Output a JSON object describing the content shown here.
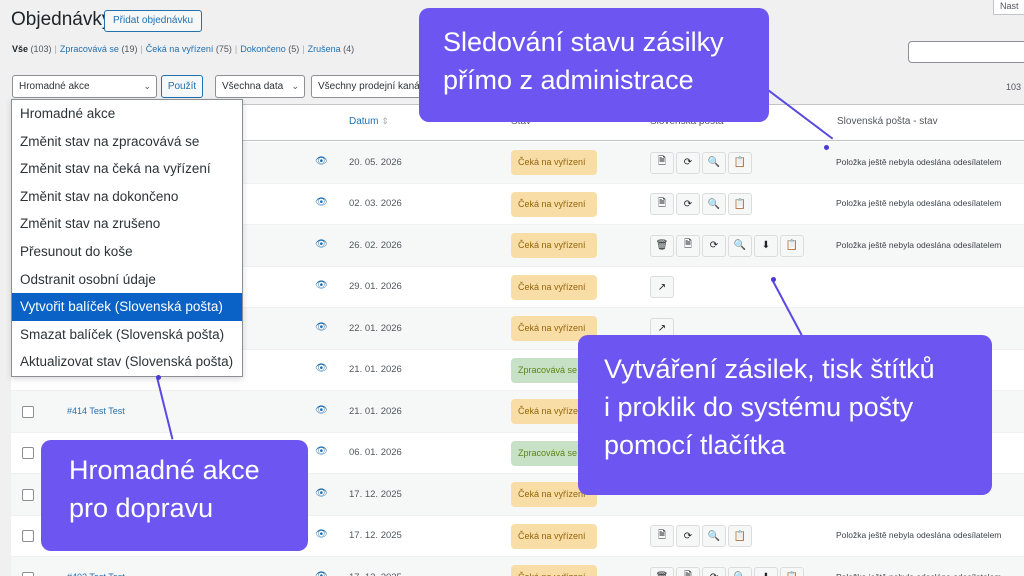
{
  "header": {
    "title": "Objednávky",
    "add_button": "Přidat objednávku",
    "screen_options": "Nast"
  },
  "views": [
    {
      "label": "Vše",
      "count": "(103)"
    },
    {
      "label": "Zpracovává se",
      "count": "(19)"
    },
    {
      "label": "Čeká na vyřízení",
      "count": "(75)"
    },
    {
      "label": "Dokončeno",
      "count": "(5)"
    },
    {
      "label": "Zrušena",
      "count": "(4)"
    }
  ],
  "filters": {
    "bulk_select": "Hromadné akce",
    "apply": "Použít",
    "date_select": "Všechna data",
    "channel_select": "Všechny prodejní kaná",
    "item_count": "103"
  },
  "table": {
    "headers": {
      "date": "Datum",
      "status": "Stav",
      "post": "Slovenská pošta",
      "post_status": "Slovenská pošta - stav"
    },
    "rows": [
      {
        "order": "",
        "date": "20. 05. 2026",
        "status": "Čeká na vyřízení",
        "status_type": "hold",
        "icons": [
          "doc",
          "refresh",
          "search",
          "sheet"
        ],
        "post_status": "Položka ještě nebyla odeslána odesílatelem"
      },
      {
        "order": "",
        "date": "02. 03. 2026",
        "status": "Čeká na vyřízení",
        "status_type": "hold",
        "icons": [
          "doc",
          "refresh",
          "search",
          "sheet"
        ],
        "post_status": "Položka ještě nebyla odeslána odesílatelem"
      },
      {
        "order": "",
        "date": "26. 02. 2026",
        "status": "Čeká na vyřízení",
        "status_type": "hold",
        "icons": [
          "trash",
          "doc",
          "refresh",
          "search",
          "download",
          "sheet"
        ],
        "post_status": "Položka ještě nebyla odeslána odesílatelem"
      },
      {
        "order": "",
        "date": "29. 01. 2026",
        "status": "Čeká na vyřízení",
        "status_type": "hold",
        "icons": [
          "external"
        ],
        "post_status": ""
      },
      {
        "order": "",
        "date": "22. 01. 2026",
        "status": "Čeká na vyřízení",
        "status_type": "hold",
        "icons": [
          "external"
        ],
        "post_status": ""
      },
      {
        "order": "",
        "date": "21. 01. 2026",
        "status": "Zpracovává se",
        "status_type": "proc",
        "icons": [],
        "post_status": "telem"
      },
      {
        "order": "#414 Test Test",
        "date": "21. 01. 2026",
        "status": "Čeká na vyřízení",
        "status_type": "hold",
        "icons": [],
        "post_status": "telem"
      },
      {
        "order": "",
        "date": "06. 01. 2026",
        "status": "Zpracovává se",
        "status_type": "proc",
        "icons": [],
        "post_status": ""
      },
      {
        "order": "",
        "date": "17. 12. 2025",
        "status": "Čeká na vyřízení",
        "status_type": "hold",
        "icons": [],
        "post_status": ""
      },
      {
        "order": "",
        "date": "17. 12. 2025",
        "status": "Čeká na vyřízení",
        "status_type": "hold",
        "icons": [
          "doc",
          "refresh",
          "search",
          "sheet"
        ],
        "post_status": "Položka ještě nebyla odeslána odesílatelem"
      },
      {
        "order": "#402 Test Test",
        "date": "17. 12. 2025",
        "status": "Čeká na vyřízení",
        "status_type": "hold",
        "icons": [
          "trash",
          "doc",
          "refresh",
          "search",
          "download",
          "sheet"
        ],
        "post_status": "Položka ještě nebyla odeslána odesílatelem"
      }
    ]
  },
  "bulk_menu": {
    "items": [
      "Hromadné akce",
      "Změnit stav na zpracovává se",
      "Změnit stav na čeká na vyřízení",
      "Změnit stav na dokončeno",
      "Změnit stav na zrušeno",
      "Přesunout do koše",
      "Odstranit osobní údaje",
      "Vytvořit balíček (Slovenská pošta)",
      "Smazat balíček (Slovenská pošta)",
      "Aktualizovat stav (Slovenská pošta)"
    ],
    "selected_index": 7
  },
  "callouts": {
    "tracking": [
      "Sledování stavu zásilky",
      "přímo z administrace"
    ],
    "shipments": [
      "Vytváření zásilek, tisk štítků",
      "i proklik do systému pošty",
      "pomocí tlačítka"
    ],
    "bulk": [
      "Hromadné akce",
      "pro dopravu"
    ]
  },
  "colors": {
    "accent": "#2271b1",
    "callout": "#6c55f0",
    "badge_hold": "#f8dda7",
    "badge_proc": "#c6e1c6",
    "selected": "#0a62c6"
  }
}
